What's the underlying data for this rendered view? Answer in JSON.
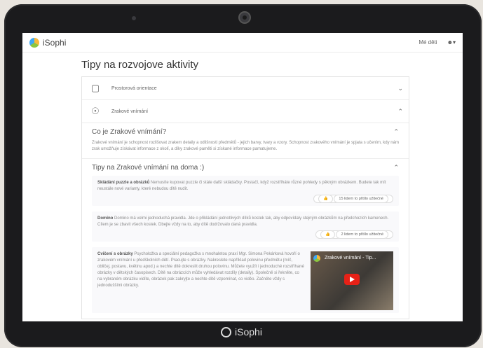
{
  "topbar": {
    "logo": "iSophi",
    "my_kids": "Mé děti",
    "user_icon": "user-icon"
  },
  "page_title": "Tipy na rozvojove aktivity",
  "accordion": [
    {
      "label": "Prostorová orientace",
      "icon": "cube-icon",
      "expanded": false
    },
    {
      "label": "Zrakové vnímání",
      "icon": "eye-icon",
      "expanded": true
    }
  ],
  "section_what": {
    "title": "Co je Zrakové vnímání?",
    "text": "Zrakové vnímání je schopnost rozlišovat zrakem detaily a odlišnosti předmětů - jejich barvy, tvary a vzory. Schopnost zrakového vnímání je spjata s učením, kdy nám zrak umožňuje získávat informace z okolí, a díky zrakové paměti si získané informace pamatujeme."
  },
  "section_tips": {
    "title": "Tipy na Zrakové vnímání na doma :)",
    "tips": [
      {
        "title": "Skládání puzzle a obrázků",
        "text": " Nemusíte kupovat puzzle či stále další skládačky. Postačí, když rozstříháte různé pohledy s pěkným obrázkem. Budete tak mít neustále nové varianty, které nebudou dítě nudit.",
        "useful": "15 lidem to přišlo užitečné"
      },
      {
        "title": "Domino",
        "text": " Domino má velmi jednoduchá pravidla. Jde o přikládání jednotlivých dílků kostek tak, aby odpovídaly stejným obrázkům na předchozích kamenech. Cílem je se zbavit všech kostek. Dbejte vždy na to, aby dítě dodržovalo daná pravidla.",
        "useful": "2 lidem to přišlo užitečné"
      },
      {
        "title": "Cvičení s obrázky",
        "text": " Psycholožka a speciální pedagožka s mnohaletou praxí Mgr. Simona Pekárková hovoří o zrakovém vnímání u předškolních dětí. Pracujte s obrázky. Nakreslete například polovinu předmětu (míč, obličej, postavu, květinu apod.) a nechte dítě dokreslit druhou polovinu. Můžete využít i jednoduché rozstříhané obrázky v dětských časopisech. Dítě na obrázcích může vyhledávat rozdíly (detaily). Společně si řekněte, co na vybraném obrázku vidíte, obrázek pak zakryjte a nechte dítě vzpomínat, co viděo. Začněte vždy s jednoduššími obrázky.",
        "video_title": "Zrakové vnímání - Tip..."
      }
    ]
  },
  "bottom_logo": "iSophi"
}
